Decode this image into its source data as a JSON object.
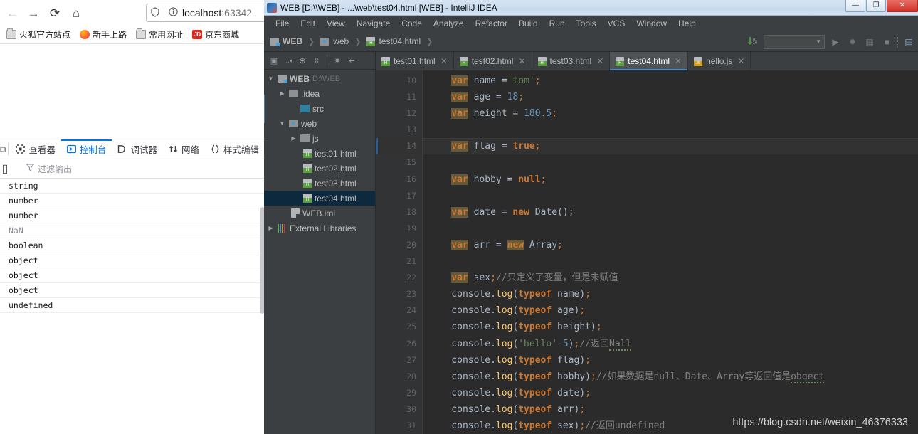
{
  "browser": {
    "nav": {
      "back_icon": "arrow-left-icon",
      "forward_icon": "arrow-right-icon",
      "reload_icon": "reload-icon",
      "home_icon": "home-icon"
    },
    "urlbar": {
      "shield_icon": "shield-icon",
      "info_icon": "info-circle-icon",
      "url_main": "localhost:",
      "url_dim": "63342"
    },
    "bookmarks": [
      {
        "label": "火狐官方站点",
        "icon": "folder-icon"
      },
      {
        "label": "新手上路",
        "icon": "firefox-icon"
      },
      {
        "label": "常用网址",
        "icon": "folder-icon"
      },
      {
        "label": "京东商城",
        "icon": "jd-icon"
      }
    ]
  },
  "devtools": {
    "tabs": [
      {
        "label": "查看器",
        "icon": "inspector-icon",
        "active": false
      },
      {
        "label": "控制台",
        "icon": "console-icon",
        "active": true
      },
      {
        "label": "调试器",
        "icon": "debugger-icon",
        "active": false
      },
      {
        "label": "网络",
        "icon": "network-icon",
        "active": false
      },
      {
        "label": "样式编辑",
        "icon": "style-editor-icon",
        "active": false
      }
    ],
    "filter": {
      "placeholder": "过滤输出",
      "icon": "filter-icon"
    },
    "console_rows": [
      {
        "text": "string",
        "muted": false
      },
      {
        "text": "number",
        "muted": false
      },
      {
        "text": "number",
        "muted": false
      },
      {
        "text": "NaN",
        "muted": true
      },
      {
        "text": "boolean",
        "muted": false
      },
      {
        "text": "object",
        "muted": false
      },
      {
        "text": "object",
        "muted": false
      },
      {
        "text": "object",
        "muted": false
      },
      {
        "text": "undefined",
        "muted": false
      }
    ]
  },
  "idea": {
    "title": "WEB [D:\\\\WEB] - ...\\web\\test04.html [WEB] - IntelliJ IDEA",
    "window_buttons": {
      "minimize": "—",
      "maximize": "❐",
      "close": "✕"
    },
    "menu": [
      "File",
      "Edit",
      "View",
      "Navigate",
      "Code",
      "Analyze",
      "Refactor",
      "Build",
      "Run",
      "Tools",
      "VCS",
      "Window",
      "Help"
    ],
    "breadcrumb": [
      {
        "label": "WEB",
        "icon": "module-icon",
        "bold": true
      },
      {
        "label": "web",
        "icon": "folder-icon"
      },
      {
        "label": "test04.html",
        "icon": "html-file-icon"
      }
    ],
    "toolbar_right": {
      "combo_value": "",
      "icons": [
        "sort-numeric-icon",
        "run-icon",
        "debug-icon",
        "coverage-icon",
        "stop-icon",
        "layout-icon"
      ]
    },
    "project_toolbar_icons": [
      "project-view-icon",
      "chevron-down-icon",
      "locate-icon",
      "collapse-all-icon",
      "settings-gear-icon",
      "hide-panel-icon"
    ],
    "tree": [
      {
        "indent": 0,
        "arrow": "▼",
        "label": "WEB",
        "sub": "D:\\WEB",
        "icon": "module-icon",
        "bold": true,
        "selected": false
      },
      {
        "indent": 1,
        "arrow": "▶",
        "label": ".idea",
        "sub": "",
        "icon": "folder-icon",
        "bold": false,
        "selected": false
      },
      {
        "indent": 2,
        "arrow": "",
        "label": "src",
        "sub": "",
        "icon": "source-folder-icon",
        "bold": false,
        "selected": false
      },
      {
        "indent": 1,
        "arrow": "▼",
        "label": "web",
        "sub": "",
        "icon": "web-folder-icon",
        "bold": false,
        "selected": false
      },
      {
        "indent": 2,
        "arrow": "▶",
        "label": "js",
        "sub": "",
        "icon": "folder-icon",
        "bold": false,
        "selected": false
      },
      {
        "indent": 3,
        "arrow": "",
        "label": "test01.html",
        "sub": "",
        "icon": "html-file-icon",
        "bold": false,
        "selected": false
      },
      {
        "indent": 3,
        "arrow": "",
        "label": "test02.html",
        "sub": "",
        "icon": "html-file-icon",
        "bold": false,
        "selected": false
      },
      {
        "indent": 3,
        "arrow": "",
        "label": "test03.html",
        "sub": "",
        "icon": "html-file-icon",
        "bold": false,
        "selected": false
      },
      {
        "indent": 3,
        "arrow": "",
        "label": "test04.html",
        "sub": "",
        "icon": "html-file-icon",
        "bold": false,
        "selected": true
      },
      {
        "indent": 2,
        "arrow": "",
        "label": "WEB.iml",
        "sub": "",
        "icon": "iml-file-icon",
        "bold": false,
        "selected": false
      },
      {
        "indent": 0,
        "arrow": "▶",
        "label": "External Libraries",
        "sub": "",
        "icon": "libraries-icon",
        "bold": false,
        "selected": false
      }
    ],
    "editor_tabs": [
      {
        "label": "test01.html",
        "icon": "html-file-icon",
        "active": false
      },
      {
        "label": "test02.html",
        "icon": "html-file-icon",
        "active": false
      },
      {
        "label": "test03.html",
        "icon": "html-file-icon",
        "active": false
      },
      {
        "label": "test04.html",
        "icon": "html-file-icon",
        "active": true
      },
      {
        "label": "hello.js",
        "icon": "js-file-icon",
        "active": false
      }
    ],
    "close_tab_glyph": "✕",
    "gutter_lines": [
      "10",
      "11",
      "12",
      "13",
      "14",
      "15",
      "16",
      "17",
      "18",
      "19",
      "20",
      "21",
      "22",
      "23",
      "24",
      "25",
      "26",
      "27",
      "28",
      "29",
      "30",
      "31"
    ],
    "current_line": "14",
    "marked_line": "17",
    "code_lines": [
      {
        "n": "10",
        "tokens": [
          {
            "t": "    ",
            "c": "plain"
          },
          {
            "t": "var",
            "c": "kw hl"
          },
          {
            "t": " name =",
            "c": "plain"
          },
          {
            "t": "'tom'",
            "c": "str"
          },
          {
            "t": ";",
            "c": "semi"
          }
        ]
      },
      {
        "n": "11",
        "tokens": [
          {
            "t": "    ",
            "c": "plain"
          },
          {
            "t": "var",
            "c": "kw hl"
          },
          {
            "t": " age = ",
            "c": "plain"
          },
          {
            "t": "18",
            "c": "num"
          },
          {
            "t": ";",
            "c": "semi"
          }
        ]
      },
      {
        "n": "12",
        "tokens": [
          {
            "t": "    ",
            "c": "plain"
          },
          {
            "t": "var",
            "c": "kw hl"
          },
          {
            "t": " height = ",
            "c": "plain"
          },
          {
            "t": "180.5",
            "c": "num"
          },
          {
            "t": ";",
            "c": "semi"
          }
        ]
      },
      {
        "n": "13",
        "tokens": []
      },
      {
        "n": "14",
        "tokens": [
          {
            "t": "    ",
            "c": "plain"
          },
          {
            "t": "var",
            "c": "kw hl"
          },
          {
            "t": " flag = ",
            "c": "plain"
          },
          {
            "t": "true",
            "c": "kw"
          },
          {
            "t": ";",
            "c": "semi"
          }
        ]
      },
      {
        "n": "15",
        "tokens": []
      },
      {
        "n": "16",
        "tokens": [
          {
            "t": "    ",
            "c": "plain"
          },
          {
            "t": "var",
            "c": "kw hl"
          },
          {
            "t": " hobby = ",
            "c": "plain"
          },
          {
            "t": "null",
            "c": "kw"
          },
          {
            "t": ";",
            "c": "semi"
          }
        ]
      },
      {
        "n": "17",
        "tokens": []
      },
      {
        "n": "18",
        "tokens": [
          {
            "t": "    ",
            "c": "plain"
          },
          {
            "t": "var",
            "c": "kw hl"
          },
          {
            "t": " date = ",
            "c": "plain"
          },
          {
            "t": "new",
            "c": "kw"
          },
          {
            "t": " Date();",
            "c": "plain"
          }
        ]
      },
      {
        "n": "19",
        "tokens": []
      },
      {
        "n": "20",
        "tokens": [
          {
            "t": "    ",
            "c": "plain"
          },
          {
            "t": "var",
            "c": "kw hl"
          },
          {
            "t": " arr = ",
            "c": "plain"
          },
          {
            "t": "new",
            "c": "kw hl"
          },
          {
            "t": " Array",
            "c": "plain hl"
          },
          {
            "t": ";",
            "c": "semi"
          }
        ]
      },
      {
        "n": "21",
        "tokens": []
      },
      {
        "n": "22",
        "tokens": [
          {
            "t": "    ",
            "c": "plain"
          },
          {
            "t": "var",
            "c": "kw hl"
          },
          {
            "t": " sex",
            "c": "plain"
          },
          {
            "t": ";",
            "c": "semi"
          },
          {
            "t": "//只定义了变量，但是未赋值",
            "c": "cm"
          }
        ]
      },
      {
        "n": "23",
        "tokens": [
          {
            "t": "    console.",
            "c": "plain"
          },
          {
            "t": "log",
            "c": "fn"
          },
          {
            "t": "(",
            "c": "plain"
          },
          {
            "t": "typeof",
            "c": "kw"
          },
          {
            "t": " name)",
            "c": "plain"
          },
          {
            "t": ";",
            "c": "semi"
          }
        ]
      },
      {
        "n": "24",
        "tokens": [
          {
            "t": "    console.",
            "c": "plain"
          },
          {
            "t": "log",
            "c": "fn"
          },
          {
            "t": "(",
            "c": "plain"
          },
          {
            "t": "typeof",
            "c": "kw"
          },
          {
            "t": " age)",
            "c": "plain"
          },
          {
            "t": ";",
            "c": "semi"
          }
        ]
      },
      {
        "n": "25",
        "tokens": [
          {
            "t": "    console.",
            "c": "plain"
          },
          {
            "t": "log",
            "c": "fn"
          },
          {
            "t": "(",
            "c": "plain"
          },
          {
            "t": "typeof",
            "c": "kw"
          },
          {
            "t": " height)",
            "c": "plain"
          },
          {
            "t": ";",
            "c": "semi"
          }
        ]
      },
      {
        "n": "26",
        "tokens": [
          {
            "t": "    console.",
            "c": "plain"
          },
          {
            "t": "log",
            "c": "fn"
          },
          {
            "t": "(",
            "c": "plain"
          },
          {
            "t": "'hello'",
            "c": "str"
          },
          {
            "t": "-",
            "c": "plain"
          },
          {
            "t": "5",
            "c": "num"
          },
          {
            "t": ")",
            "c": "plain"
          },
          {
            "t": ";",
            "c": "semi"
          },
          {
            "t": "//返回",
            "c": "cm"
          },
          {
            "t": "Nall",
            "c": "cm err"
          }
        ]
      },
      {
        "n": "27",
        "tokens": [
          {
            "t": "    console.",
            "c": "plain"
          },
          {
            "t": "log",
            "c": "fn"
          },
          {
            "t": "(",
            "c": "plain"
          },
          {
            "t": "typeof",
            "c": "kw"
          },
          {
            "t": " flag)",
            "c": "plain"
          },
          {
            "t": ";",
            "c": "semi"
          }
        ]
      },
      {
        "n": "28",
        "tokens": [
          {
            "t": "    console.",
            "c": "plain"
          },
          {
            "t": "log",
            "c": "fn"
          },
          {
            "t": "(",
            "c": "plain"
          },
          {
            "t": "typeof",
            "c": "kw"
          },
          {
            "t": " hobby)",
            "c": "plain"
          },
          {
            "t": ";",
            "c": "semi"
          },
          {
            "t": "//如果数据是null、Date、Array等返回值是",
            "c": "cm"
          },
          {
            "t": "obgect",
            "c": "cm err"
          }
        ]
      },
      {
        "n": "29",
        "tokens": [
          {
            "t": "    console.",
            "c": "plain"
          },
          {
            "t": "log",
            "c": "fn"
          },
          {
            "t": "(",
            "c": "plain"
          },
          {
            "t": "typeof",
            "c": "kw"
          },
          {
            "t": " date)",
            "c": "plain"
          },
          {
            "t": ";",
            "c": "semi"
          }
        ]
      },
      {
        "n": "30",
        "tokens": [
          {
            "t": "    console.",
            "c": "plain"
          },
          {
            "t": "log",
            "c": "fn"
          },
          {
            "t": "(",
            "c": "plain"
          },
          {
            "t": "typeof",
            "c": "kw"
          },
          {
            "t": " arr)",
            "c": "plain"
          },
          {
            "t": ";",
            "c": "semi"
          }
        ]
      },
      {
        "n": "31",
        "tokens": [
          {
            "t": "    console.",
            "c": "plain"
          },
          {
            "t": "log",
            "c": "fn"
          },
          {
            "t": "(",
            "c": "plain"
          },
          {
            "t": "typeof",
            "c": "kw"
          },
          {
            "t": " sex)",
            "c": "plain"
          },
          {
            "t": ";",
            "c": "semi"
          },
          {
            "t": "//返回undefined",
            "c": "cm"
          }
        ]
      }
    ],
    "watermark": "https://blog.csdn.net/weixin_46376333"
  },
  "colors": {
    "idea_bg": "#3c3f41",
    "editor_bg": "#2b2b2b",
    "accent_blue": "#4a88c7",
    "keyword_orange": "#cc7832",
    "string_green": "#6a8759",
    "number_blue": "#6897bb",
    "function_yellow": "#ffc66d",
    "comment_gray": "#808080",
    "devtools_active": "#0074e8",
    "selection_navy": "#0d293e"
  }
}
